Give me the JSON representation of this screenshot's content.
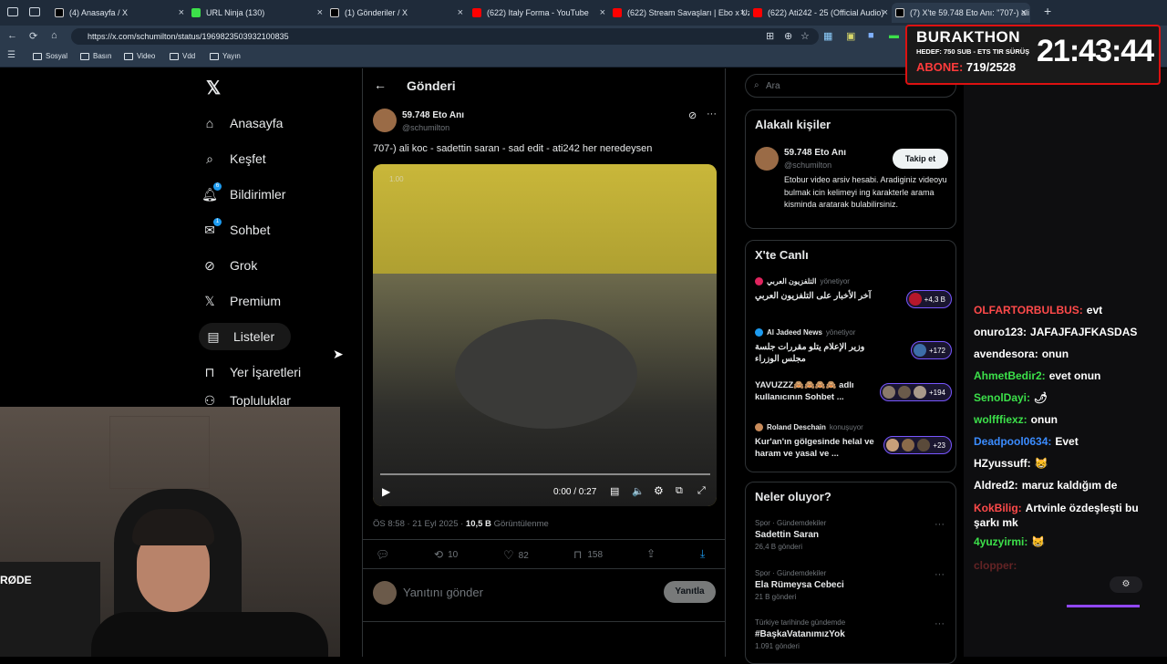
{
  "browser": {
    "tabs": [
      {
        "label": "(4) Anasayfa / X",
        "fav": "x-logo"
      },
      {
        "label": "URL Ninja (130)",
        "fav": "page"
      },
      {
        "label": "(1) Gönderiler / X",
        "fav": "x-logo"
      },
      {
        "label": "(622) Italy Forma - YouTube",
        "fav": "youtube"
      },
      {
        "label": "(622) Stream Savaşları | Ebo x Uz",
        "fav": "youtube"
      },
      {
        "label": "(622) Ati242 - 25 (Official Audio)",
        "fav": "youtube"
      },
      {
        "label": "(7) X'te 59.748 Eto Anı: \"707-) ali",
        "fav": "x-logo"
      }
    ],
    "url": "https://x.com/schumilton/status/1969823503932100835",
    "bookmarks": [
      "Sosyal",
      "Basın",
      "Video",
      "Vdd",
      "Yayın"
    ]
  },
  "nav": {
    "items": [
      {
        "label": "Anasayfa",
        "icon": "home-icon"
      },
      {
        "label": "Keşfet",
        "icon": "search-icon"
      },
      {
        "label": "Bildirimler",
        "icon": "bell-icon",
        "badge": "6"
      },
      {
        "label": "Sohbet",
        "icon": "mail-icon",
        "badge": "1"
      },
      {
        "label": "Grok",
        "icon": "grok-icon"
      },
      {
        "label": "Premium",
        "icon": "x-logo-icon"
      },
      {
        "label": "Listeler",
        "icon": "list-icon"
      },
      {
        "label": "Yer İşaretleri",
        "icon": "bookmark-icon"
      },
      {
        "label": "Topluluklar",
        "icon": "communities-icon"
      }
    ]
  },
  "post": {
    "header_title": "Gönderi",
    "author_name": "59.748 Eto Anı",
    "author_handle": "@schumilton",
    "text": "707-) ali koc - sadettin saran - sad edit - ati242 her neredeysen",
    "video_time": "0:00 / 0:27",
    "video_rate": "1.00",
    "timestamp": "ÖS 8:58 · 21 Eyl 2025 ·",
    "views_value": "10,5 B",
    "views_label": "Görüntülenme",
    "reposts": "10",
    "likes": "82",
    "bookmarks": "158",
    "reply_placeholder": "Yanıtını gönder",
    "reply_button": "Yanıtla"
  },
  "right": {
    "search_placeholder": "Ara",
    "related_title": "Alakalı kişiler",
    "related_name": "59.748 Eto Anı",
    "related_handle": "@schumilton",
    "related_bio": "Etobur video arsiv hesabi. Aradiginiz videoyu bulmak icin kelimeyi ing karakterle arama kisminda aratarak bulabilirsiniz.",
    "follow_button": "Takip et",
    "live_title": "X'te Canlı",
    "live": [
      {
        "source": "التلفزيون العربي",
        "role": "yönetiyor",
        "title": "آخر الأخبار على التلفزيون العربي",
        "count": "+4,3 B"
      },
      {
        "source": "Al Jadeed News",
        "role": "yönetiyor",
        "title": "وزير الإعلام يتلو مقررات جلسة مجلس الوزراء",
        "count": "+172"
      },
      {
        "source": "",
        "role": "",
        "title": "YAVUZZZ🙈🙈🙈🙈 adlı kullanıcının Sohbet ...",
        "count": "+194"
      },
      {
        "source": "Roland Deschain",
        "role": "konuşuyor",
        "title": "Kur'an'ın gölgesinde helal ve haram ve yasal ve ...",
        "count": "+23"
      }
    ],
    "trends_title": "Neler oluyor?",
    "trends": [
      {
        "category": "Spor · Gündemdekiler",
        "title": "Sadettin Saran",
        "count": "26,4 B gönderi"
      },
      {
        "category": "Spor · Gündemdekiler",
        "title": "Ela Rümeysa Cebeci",
        "count": "21 B gönderi"
      },
      {
        "category": "Türkiye tarihinde gündemde",
        "title": "#BaşkaVatanımızYok",
        "count": "1.091 gönderi"
      }
    ]
  },
  "overlay": {
    "title": "BURAKTHON",
    "line1": "HEDEF: 750 SUB - ETS TIR SÜRÜŞ",
    "line2_label": "ABONE:",
    "line2_value": "719/2528",
    "clock": "21:43:44"
  },
  "chat": [
    {
      "user": "OLFARTORBULBUS:",
      "msg": "evt",
      "color": "#ff4a4a"
    },
    {
      "user": "onuro123:",
      "msg": "JAFAJFAJFKASDAS",
      "color": "#ffffff"
    },
    {
      "user": "avendesora:",
      "msg": "onun",
      "color": "#ffffff"
    },
    {
      "user": "AhmetBedir2:",
      "msg": "evet onun",
      "color": "#3ce04a"
    },
    {
      "user": "SenolDayi:",
      "msg": "🌶",
      "color": "#3ce04a"
    },
    {
      "user": "wolfffiexz:",
      "msg": "onun",
      "color": "#3ce04a"
    },
    {
      "user": "Deadpool0634:",
      "msg": "Evet",
      "color": "#3b8cff"
    },
    {
      "user": "HZyussuff:",
      "msg": "😸",
      "color": "#ffffff"
    },
    {
      "user": "Aldred2:",
      "msg": "maruz kaldığım de",
      "color": "#ffffff"
    },
    {
      "user": "KokBilig:",
      "msg": "Artvinle özdeşleşti bu şarkı mk",
      "color": "#ff4a4a"
    },
    {
      "user": "4yuzyirmi:",
      "msg": "😸",
      "color": "#3ce04a"
    },
    {
      "user": "clopper:",
      "msg": "",
      "color": "#ff4a4a"
    }
  ],
  "webcam_mic_label": "RØDE"
}
